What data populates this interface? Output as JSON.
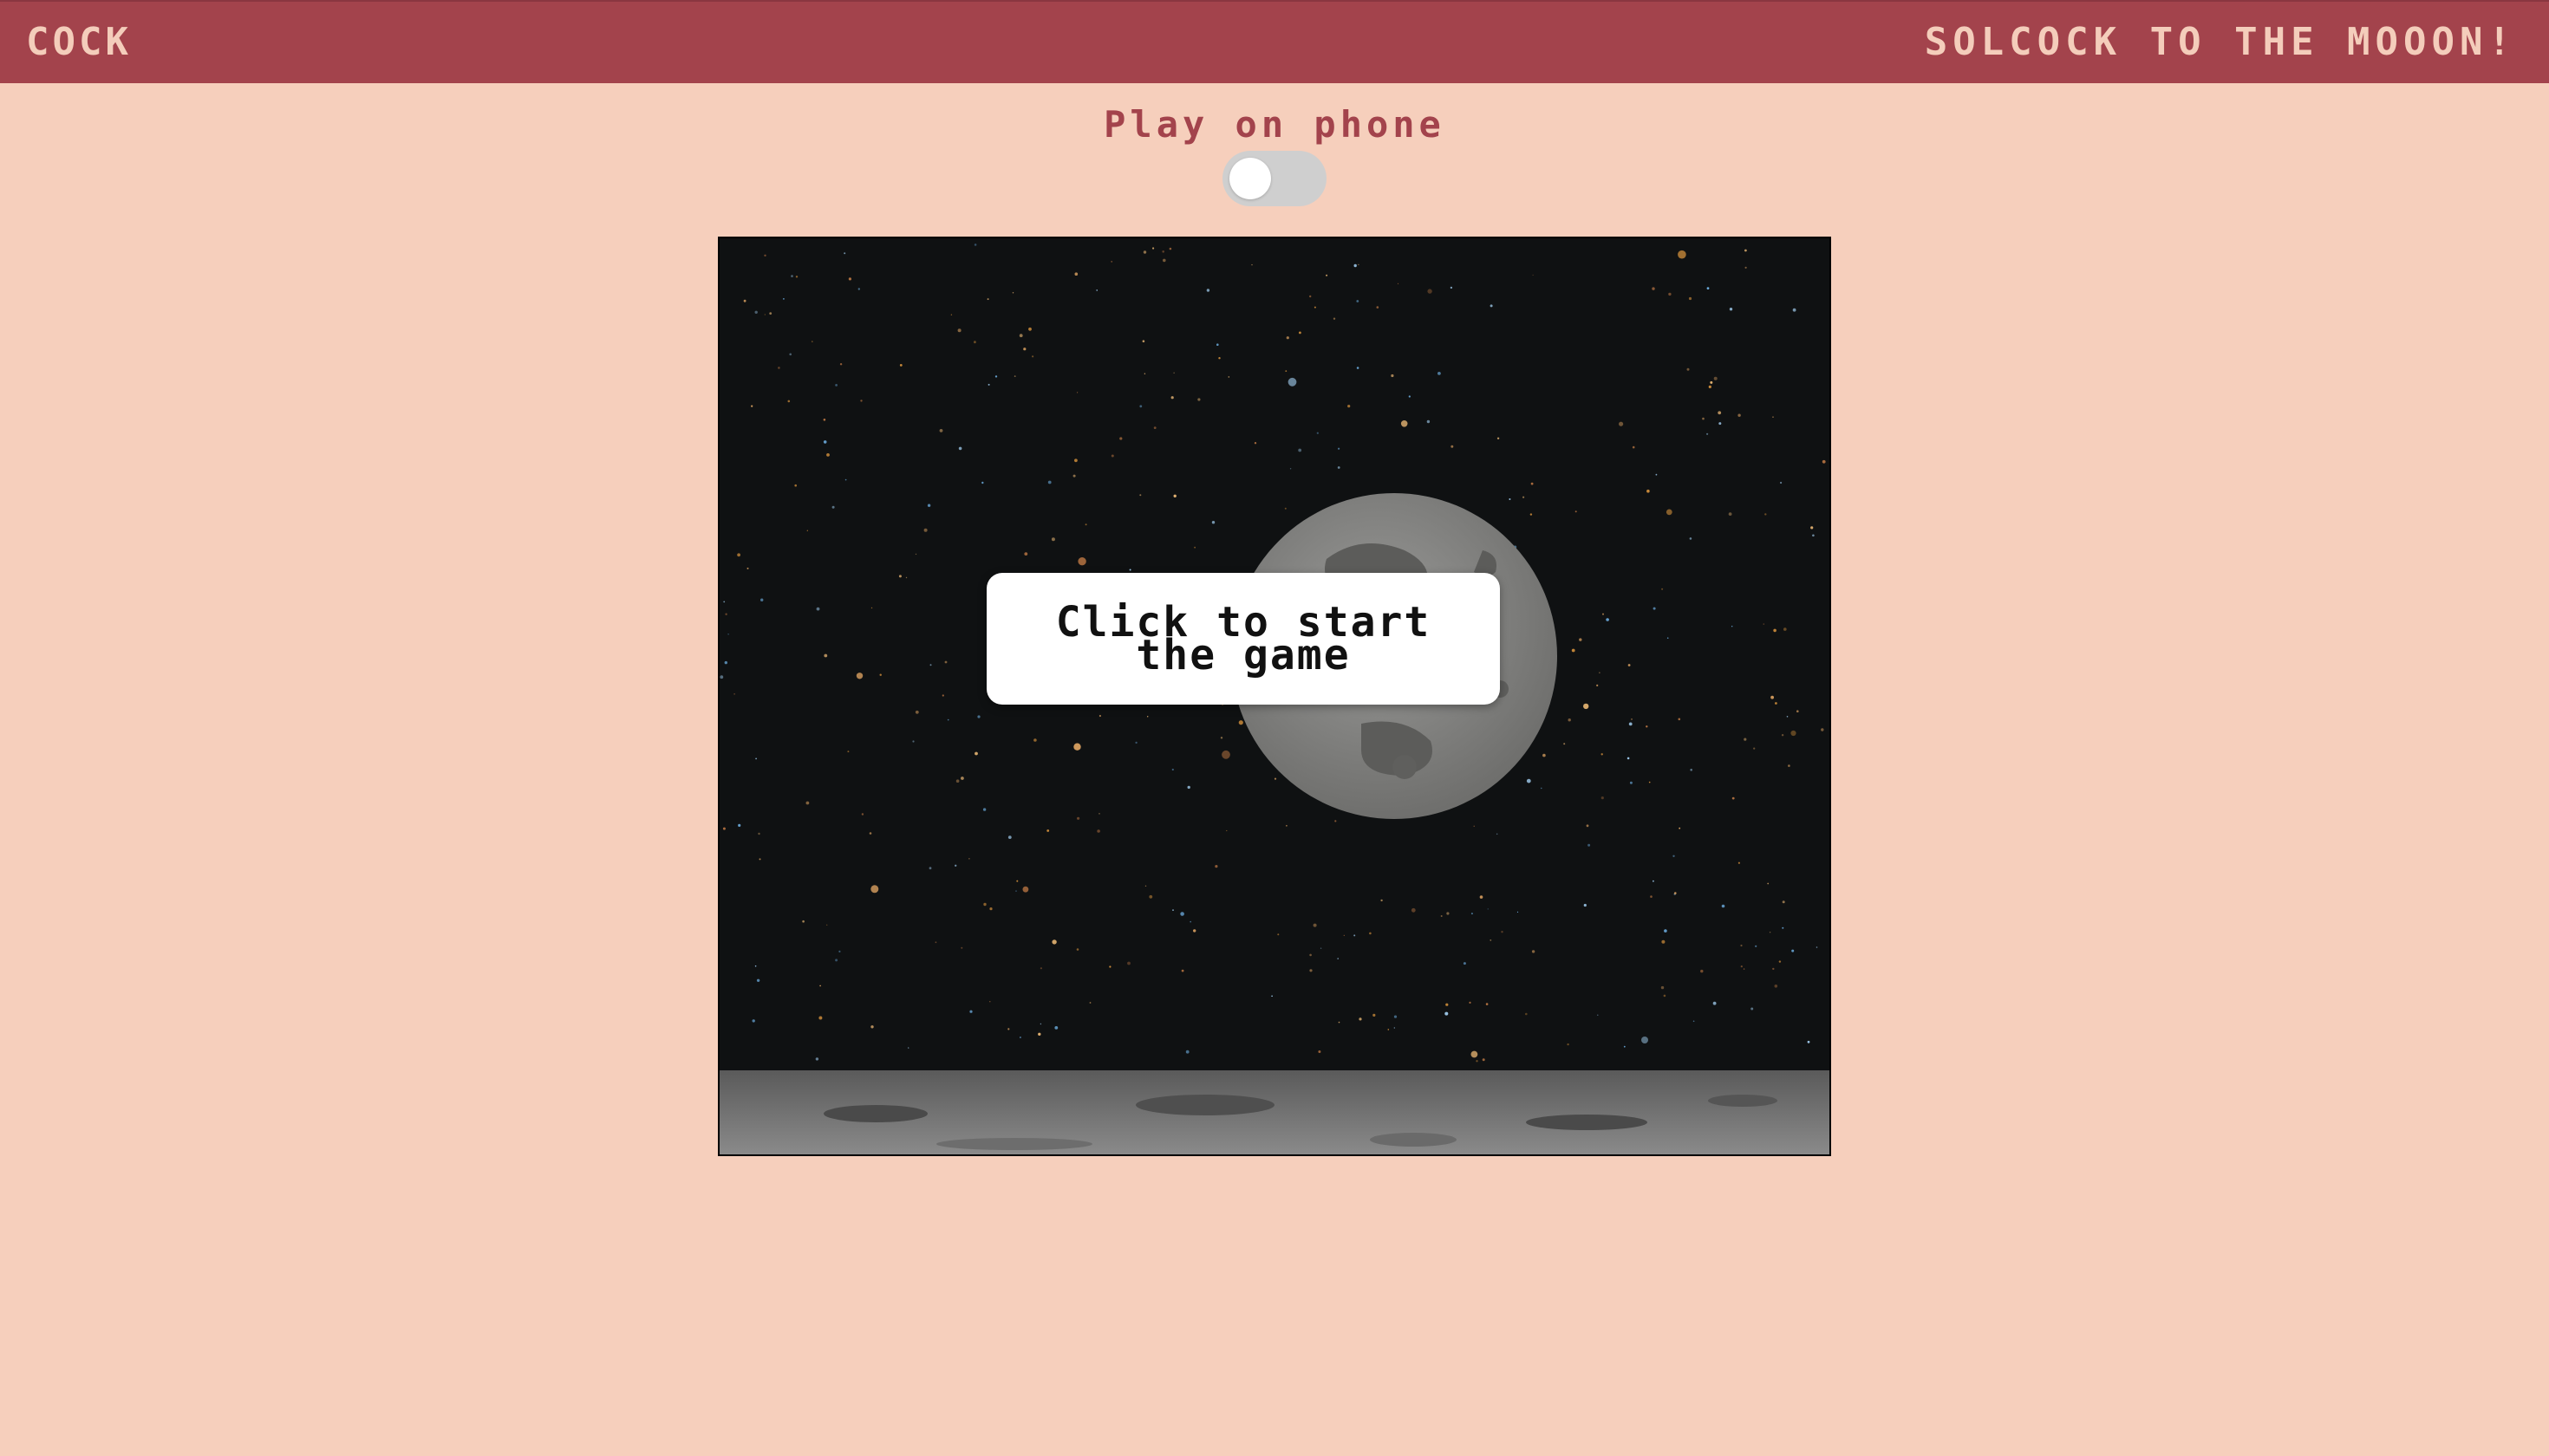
{
  "header": {
    "brand": "COCK",
    "tagline": "SOLCOCK TO THE MOOON!"
  },
  "controls": {
    "phone_label": "Play on phone",
    "phone_toggle_on": false
  },
  "game": {
    "start_prompt": "Click to start the game"
  },
  "colors": {
    "header_bg": "#a3434c",
    "page_bg": "#f6cfbc",
    "accent_text": "#a3434c",
    "header_text": "#f4cdbb"
  },
  "icons": [
    "moon-icon",
    "stars-background",
    "lunar-surface",
    "toggle-switch"
  ]
}
